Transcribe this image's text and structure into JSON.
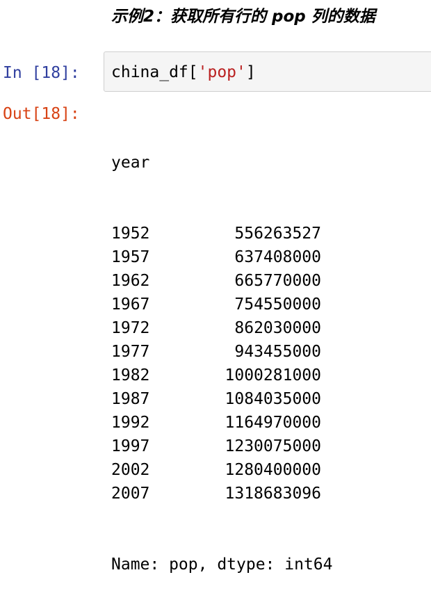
{
  "heading": "示例2：获取所有行的 pop 列的数据",
  "cell_input": {
    "prompt": "In [18]:",
    "code_prefix": "china_df[",
    "code_string": "'pop'",
    "code_suffix": "]"
  },
  "cell_output": {
    "prompt": "Out[18]:",
    "index_name": "year",
    "rows": [
      {
        "year": "1952",
        "value": "556263527"
      },
      {
        "year": "1957",
        "value": "637408000"
      },
      {
        "year": "1962",
        "value": "665770000"
      },
      {
        "year": "1967",
        "value": "754550000"
      },
      {
        "year": "1972",
        "value": "862030000"
      },
      {
        "year": "1977",
        "value": "943455000"
      },
      {
        "year": "1982",
        "value": "1000281000"
      },
      {
        "year": "1987",
        "value": "1084035000"
      },
      {
        "year": "1992",
        "value": "1164970000"
      },
      {
        "year": "1997",
        "value": "1230075000"
      },
      {
        "year": "2002",
        "value": "1280400000"
      },
      {
        "year": "2007",
        "value": "1318683096"
      }
    ],
    "footer": "Name: pop, dtype: int64"
  },
  "colors": {
    "in_prompt": "#303f9f",
    "out_prompt": "#d84315",
    "string_literal": "#ba2121",
    "input_background": "#f5f5f5"
  }
}
